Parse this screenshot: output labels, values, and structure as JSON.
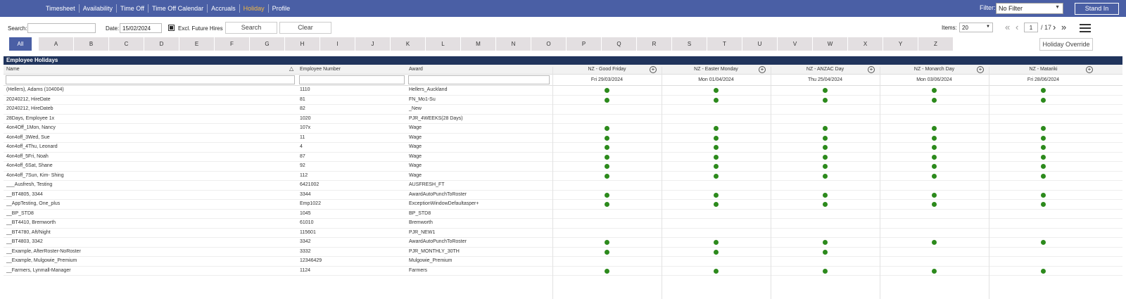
{
  "nav": {
    "tabs": [
      "Timesheet",
      "Availability",
      "Time Off",
      "Time Off Calendar",
      "Accruals",
      "Holiday",
      "Profile"
    ],
    "active_tab": "Holiday",
    "filter_label": "Filter:",
    "filter_value": "No Filter",
    "stand_in_label": "Stand In"
  },
  "toolbar": {
    "search_label": "Search:",
    "search_value": "",
    "date_label": "Date:",
    "date_value": "15/02/2024",
    "excl_label": "Excl. Future Hires",
    "search_button": "Search",
    "clear_button": "Clear",
    "items_label": "Items:",
    "items_value": "20",
    "page_value": "1",
    "page_total": "/ 17",
    "holiday_override": "Holiday Override"
  },
  "letters": [
    "All",
    "A",
    "B",
    "C",
    "D",
    "E",
    "F",
    "G",
    "H",
    "I",
    "J",
    "K",
    "L",
    "M",
    "N",
    "O",
    "P",
    "Q",
    "R",
    "S",
    "T",
    "U",
    "V",
    "W",
    "X",
    "Y",
    "Z"
  ],
  "grid": {
    "title": "Employee Holidays",
    "columns": {
      "name": "Name",
      "number": "Employee Number",
      "award": "Award"
    },
    "holidays": [
      {
        "name": "NZ - Good Friday",
        "date": "Fri 29/03/2024"
      },
      {
        "name": "NZ - Easter Monday",
        "date": "Mon 01/04/2024"
      },
      {
        "name": "NZ - ANZAC Day",
        "date": "Thu 25/04/2024"
      },
      {
        "name": "NZ - Monarch Day",
        "date": "Mon 03/06/2024"
      },
      {
        "name": "NZ - Matariki",
        "date": "Fri 28/06/2024"
      }
    ],
    "rows": [
      {
        "name": "(Hellers), Adams (104004)",
        "number": "1110",
        "award": "Hellers_Auckland",
        "h": [
          1,
          1,
          1,
          1,
          1
        ]
      },
      {
        "name": "20240212, HireDate",
        "number": "81",
        "award": "FN_Mo1-Su",
        "h": [
          1,
          1,
          1,
          1,
          1
        ]
      },
      {
        "name": "20240212, HireDateb",
        "number": "82",
        "award": "_New",
        "h": [
          0,
          0,
          0,
          0,
          0
        ]
      },
      {
        "name": "28Days, Employee 1x",
        "number": "1020",
        "award": "PJR_4WEEKS(28 Days)",
        "h": [
          0,
          0,
          0,
          0,
          0
        ]
      },
      {
        "name": "4on4Off_1Mon, Nancy",
        "number": "107x",
        "award": "Wage",
        "h": [
          1,
          1,
          1,
          1,
          1
        ]
      },
      {
        "name": "4on4off_3Wed, Sue",
        "number": "11",
        "award": "Wage",
        "h": [
          1,
          1,
          1,
          1,
          1
        ]
      },
      {
        "name": "4on4off_4Thu, Leonard",
        "number": "4",
        "award": "Wage",
        "h": [
          1,
          1,
          1,
          1,
          1
        ]
      },
      {
        "name": "4on4off_5Fri, Noah",
        "number": "87",
        "award": "Wage",
        "h": [
          1,
          1,
          1,
          1,
          1
        ]
      },
      {
        "name": "4on4off_6Sat, Shane",
        "number": "92",
        "award": "Wage",
        "h": [
          1,
          1,
          1,
          1,
          1
        ]
      },
      {
        "name": "4on4off_7Sun, Kim- Shing",
        "number": "112",
        "award": "Wage",
        "h": [
          1,
          1,
          1,
          1,
          1
        ]
      },
      {
        "name": "___Ausfresh, Testing",
        "number": "6421002",
        "award": "AUSFRESH_FT",
        "h": [
          0,
          0,
          0,
          0,
          0
        ]
      },
      {
        "name": "__BT4805, 3344",
        "number": "3344",
        "award": "AwardAutoPunchToRoster",
        "h": [
          1,
          1,
          1,
          1,
          1
        ]
      },
      {
        "name": "__AppTesting, One_plus",
        "number": "Emp1022",
        "award": "ExceptionWindowDefaultasper+",
        "h": [
          1,
          1,
          1,
          1,
          1
        ]
      },
      {
        "name": "__BP_STD8",
        "number": "1045",
        "award": "BP_STD8",
        "h": [
          0,
          0,
          0,
          0,
          0
        ]
      },
      {
        "name": "__BT4410, Bremworth",
        "number": "61010",
        "award": "Bremworth",
        "h": [
          0,
          0,
          0,
          0,
          0
        ]
      },
      {
        "name": "__BT4780, Aft/Night",
        "number": "115601",
        "award": "PJR_NEW1",
        "h": [
          0,
          0,
          0,
          0,
          0
        ]
      },
      {
        "name": "__BT4803, 3342",
        "number": "3342",
        "award": "AwardAutoPunchToRoster",
        "h": [
          1,
          1,
          1,
          1,
          1
        ]
      },
      {
        "name": "__Example, AfterRoster-NoRoster",
        "number": "3332",
        "award": "PJR_MONTHLY_30TH",
        "h": [
          1,
          1,
          1,
          0,
          0
        ]
      },
      {
        "name": "__Example, Mulgowie_Premium",
        "number": "12346429",
        "award": "Mulgowie_Premium",
        "h": [
          0,
          0,
          0,
          0,
          0
        ]
      },
      {
        "name": "__Farmers, Lynmall-Manager",
        "number": "1124",
        "award": "Farmers",
        "h": [
          1,
          1,
          1,
          1,
          1
        ]
      }
    ]
  },
  "colors": {
    "nav_bg": "#4a5fa5",
    "active_tab": "#f4b942",
    "grid_header": "#20345c",
    "dot": "#2c8a1c"
  }
}
